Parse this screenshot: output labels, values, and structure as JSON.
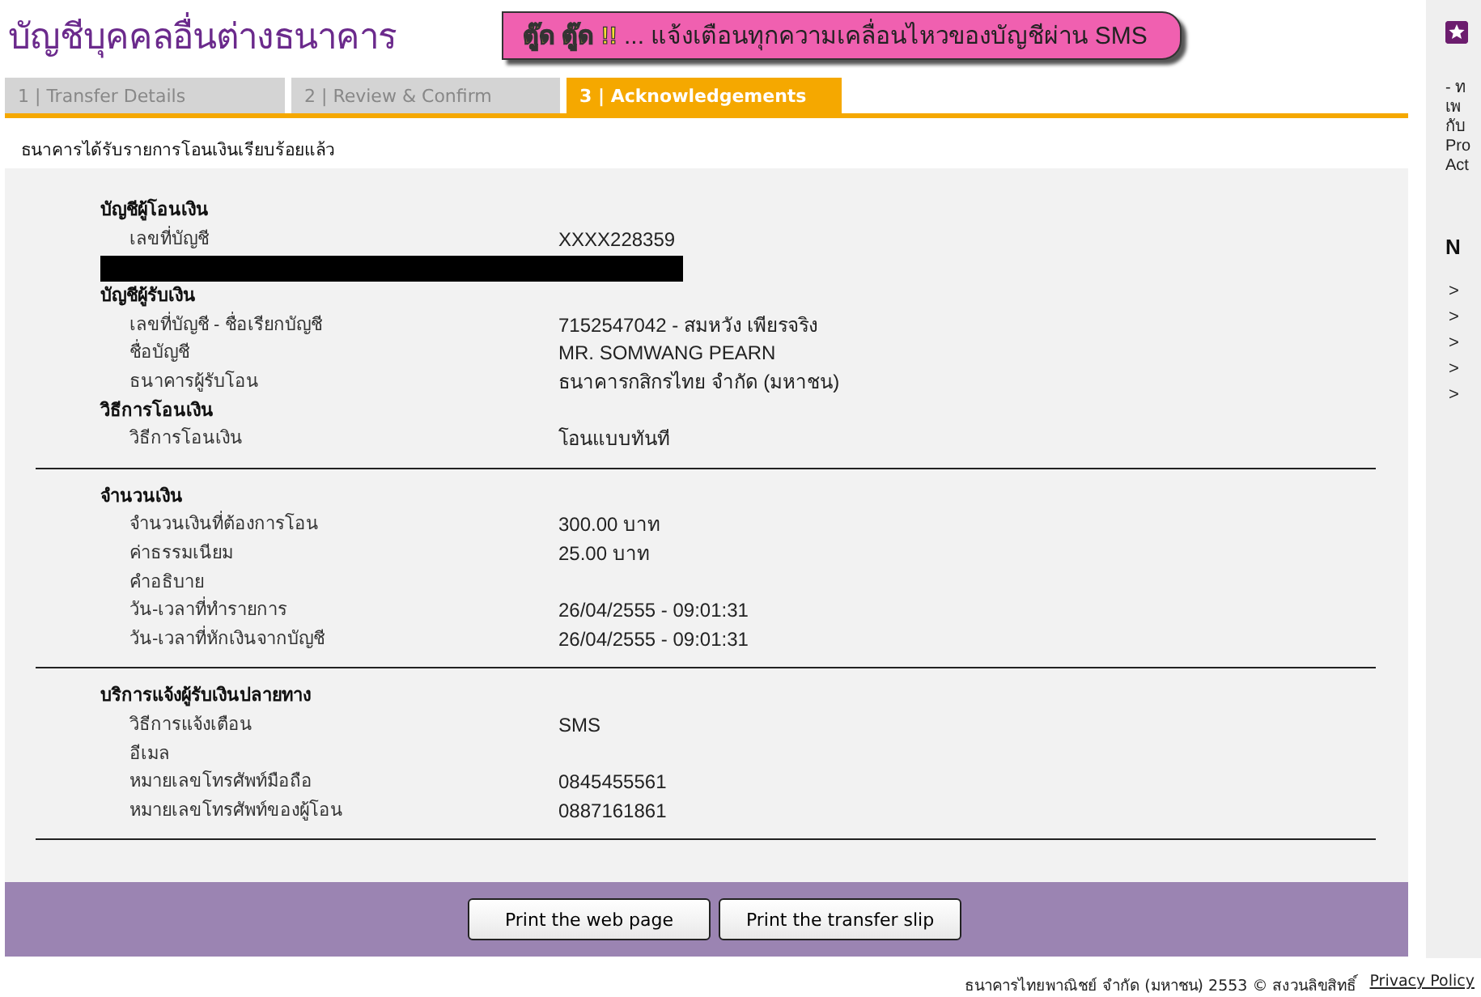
{
  "page_title": "บัญชีบุคคลอื่นต่างธนาคาร",
  "banner": {
    "highlight": "ตู๊ด ตู๊ด !!",
    "text": "... แจ้งเตือนทุกความเคลื่อนไหวของบัญชีผ่าน SMS"
  },
  "tabs": [
    {
      "label": "1 | Transfer Details",
      "selected": false
    },
    {
      "label": "2 | Review & Confirm",
      "selected": false
    },
    {
      "label": "3 | Acknowledgements",
      "selected": true
    }
  ],
  "message": "ธนาคารได้รับรายการโอนเงินเรียบร้อยแล้ว",
  "blocks": [
    {
      "sections": [
        {
          "heading": "บัญชีผู้โอนเงิน",
          "rows": [
            {
              "kind": "field",
              "label": "เลขที่บัญชี",
              "value": "XXXX228359"
            },
            {
              "kind": "redacted"
            }
          ]
        },
        {
          "heading": "บัญชีผู้รับเงิน",
          "rows": [
            {
              "kind": "field",
              "label": "เลขที่บัญชี - ชื่อเรียกบัญชี",
              "value": "7152547042 - สมหวัง เพียรจริง"
            },
            {
              "kind": "field",
              "label": "ชื่อบัญชี",
              "value": "MR. SOMWANG PEARN"
            },
            {
              "kind": "field",
              "label": "ธนาคารผู้รับโอน",
              "value": "ธนาคารกสิกรไทย จำกัด (มหาชน)"
            }
          ]
        },
        {
          "heading": "วิธีการโอนเงิน",
          "rows": [
            {
              "kind": "field",
              "label": "วิธีการโอนเงิน",
              "value": "โอนแบบทันที"
            }
          ]
        }
      ]
    },
    {
      "sections": [
        {
          "heading": "จำนวนเงิน",
          "rows": [
            {
              "kind": "field",
              "label": "จำนวนเงินที่ต้องการโอน",
              "value": "300.00 บาท"
            },
            {
              "kind": "field",
              "label": "ค่าธรรมเนียม",
              "value": "25.00  บาท"
            },
            {
              "kind": "field",
              "label": "คำอธิบาย"
            },
            {
              "kind": "field",
              "label": "วัน-เวลาที่ทำรายการ",
              "value": "26/04/2555 - 09:01:31"
            },
            {
              "kind": "field",
              "label": "วัน-เวลาที่หักเงินจากบัญชี",
              "value": "26/04/2555 - 09:01:31"
            }
          ]
        }
      ]
    },
    {
      "sections": [
        {
          "heading": "บริการแจ้งผู้รับเงินปลายทาง",
          "rows": [
            {
              "kind": "field",
              "label": "วิธีการแจ้งเตือน",
              "value": "SMS"
            },
            {
              "kind": "field",
              "label": "อีเมล"
            },
            {
              "kind": "field",
              "label": "หมายเลขโทรศัพท์มือถือ",
              "value": "0845455561"
            },
            {
              "kind": "field",
              "label": "หมายเลขโทรศัพท์ของผู้โอน",
              "value": "0887161861"
            }
          ]
        }
      ]
    }
  ],
  "buttons": [
    "Print the web page",
    "Print the transfer slip"
  ],
  "footer": {
    "copyright": "ธนาคารไทยพาณิชย์ จำกัด (มหาชน) 2553 © สงวนลิขสิทธิ์",
    "link": "Privacy Policy"
  },
  "sidebar": {
    "lines": [
      "- ท",
      "เพ",
      "กับ",
      "Pro",
      "Act"
    ],
    "heading": "N",
    "links": [
      ">",
      ">",
      ">",
      ">",
      ">"
    ]
  }
}
